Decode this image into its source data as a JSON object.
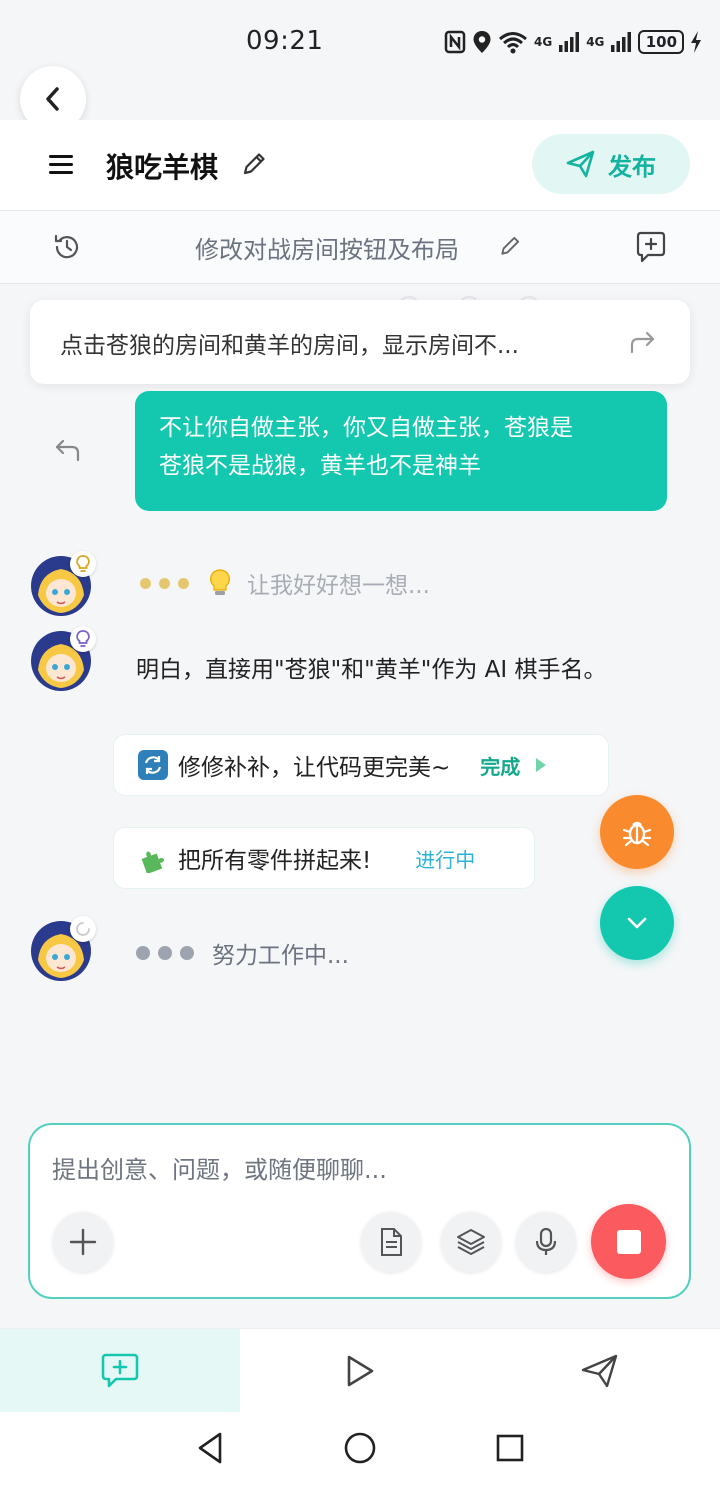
{
  "status_bar": {
    "time": "09:21",
    "battery": "100",
    "signal1": "4G",
    "signal2": "4G"
  },
  "header": {
    "title": "狼吃羊棋",
    "publish_label": "发布"
  },
  "subbar": {
    "title": "修改对战房间按钮及布局"
  },
  "quote": {
    "text": "点击苍狼的房间和黄羊的房间，显示房间不..."
  },
  "user_message": {
    "line1": "不让你自做主张，你又自做主张，苍狼是",
    "line2": "苍狼不是战狼，黄羊也不是神羊"
  },
  "assistant": {
    "thinking_text": "让我好好想一想...",
    "answer_text": "明白，直接用\"苍狼\"和\"黄羊\"作为 AI 棋手名。",
    "working_text": "努力工作中..."
  },
  "tasks": [
    {
      "label": "修修补补，让代码更完美~",
      "status": "完成",
      "icon": "refresh-icon"
    },
    {
      "label": "把所有零件拼起来!",
      "status": "进行中",
      "icon": "puzzle-icon"
    }
  ],
  "composer": {
    "placeholder": "提出创意、问题，或随便聊聊..."
  },
  "colors": {
    "accent": "#14c8b0",
    "stop": "#fb5a5f",
    "bug": "#f98b2e",
    "done": "#13a88c",
    "in_progress": "#2cb3d9"
  }
}
